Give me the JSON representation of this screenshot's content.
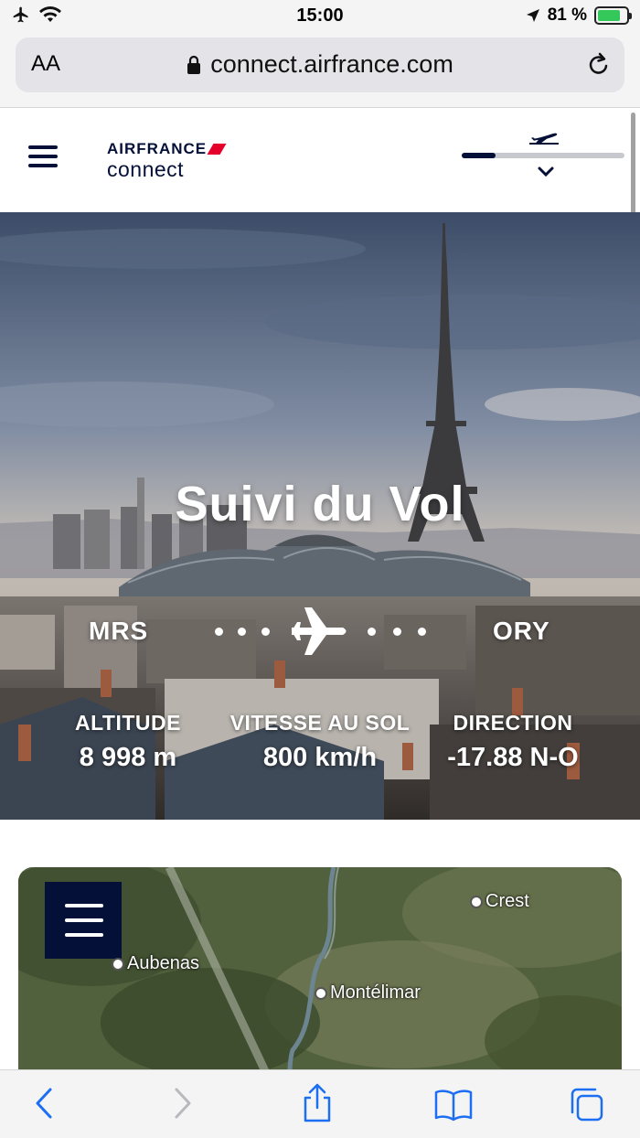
{
  "status_bar": {
    "time": "15:00",
    "battery_percent": "81 %",
    "battery_level": 0.81,
    "icons": [
      "airplane-mode-icon",
      "wifi-icon",
      "location-arrow-icon",
      "battery-charging-icon"
    ]
  },
  "browser": {
    "text_size_label": "AA",
    "url": "connect.airfrance.com",
    "lock_icon": "lock-icon",
    "reload_icon": "reload-icon"
  },
  "header": {
    "menu_icon": "hamburger-menu-icon",
    "logo_brand": "AIRFRANCE",
    "logo_product": "connect",
    "flight_progress": 0.21,
    "progress_icon": "plane-takeoff-icon",
    "expand_icon": "chevron-down-icon"
  },
  "hero": {
    "title": "Suivi du Vol",
    "origin": "MRS",
    "destination": "ORY",
    "stats": [
      {
        "label": "ALTITUDE",
        "value": "8 998 m"
      },
      {
        "label": "VITESSE AU SOL",
        "value": "800 km/h"
      },
      {
        "label": "DIRECTION",
        "value": "-17.88 N-O"
      }
    ]
  },
  "map": {
    "menu_icon": "map-menu-icon",
    "places": [
      "Crest",
      "Aubenas",
      "Montélimar"
    ]
  },
  "toolbar": {
    "items": [
      "back-icon",
      "forward-icon",
      "share-icon",
      "bookmarks-icon",
      "tabs-icon"
    ]
  },
  "colors": {
    "brand_navy": "#051039",
    "brand_red": "#e4002b",
    "ios_blue": "#1c6ef2",
    "ios_green": "#34c759"
  }
}
